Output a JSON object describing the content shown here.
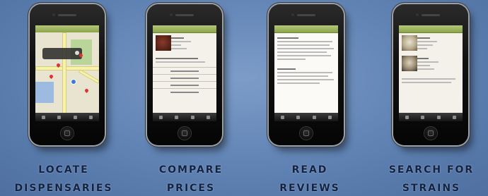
{
  "features": [
    {
      "line1": "LOCATE",
      "line2": "DISPENSARIES",
      "screen": "map"
    },
    {
      "line1": "COMPARE",
      "line2": "PRICES",
      "screen": "prices"
    },
    {
      "line1": "READ",
      "line2": "REVIEWS",
      "screen": "reviews"
    },
    {
      "line1": "SEARCH FOR",
      "line2": "STRAINS",
      "screen": "strains"
    }
  ],
  "colors": {
    "background": "#6a8cbf",
    "caption_text": "#14233f",
    "app_bar": "#8aa54a"
  }
}
